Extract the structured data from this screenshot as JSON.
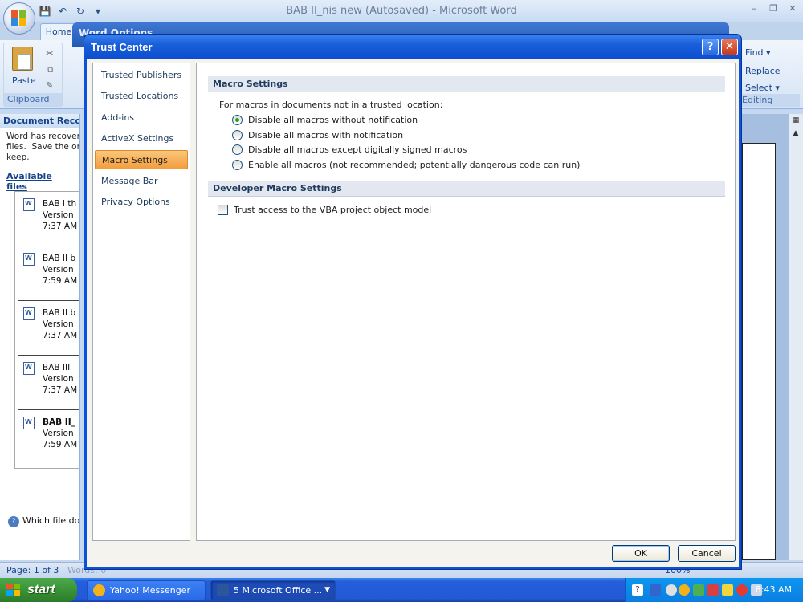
{
  "word": {
    "title": "BAB II_nis new (Autosaved) - Microsoft Word",
    "home_tab": "Home",
    "paste_label": "Paste",
    "clipboard_group": "Clipboard",
    "editing": {
      "find": "Find ▾",
      "replace": "Replace",
      "select": "Select ▾",
      "group": "Editing"
    },
    "status_page": "Page: 1 of 3",
    "status_words": "Words: 0",
    "status_zoom": "100%"
  },
  "recovery": {
    "title": "Document Recovery",
    "message": "Word has recovered\nfiles.  Save the ones\nkeep.",
    "available": "Available files",
    "files": [
      {
        "name": "BAB I th",
        "version": "Version",
        "time": "7:37 AM"
      },
      {
        "name": "BAB II b",
        "version": "Version",
        "time": "7:59 AM"
      },
      {
        "name": "BAB II b",
        "version": "Version",
        "time": "7:37 AM"
      },
      {
        "name": "BAB III",
        "version": "Version",
        "time": "7:37 AM"
      },
      {
        "name": "BAB II_",
        "version": "Version",
        "time": "7:59 AM"
      }
    ],
    "help_link": "Which file do"
  },
  "word_options": {
    "title": "Word Options"
  },
  "trust_center": {
    "title": "Trust Center",
    "nav": [
      "Trusted Publishers",
      "Trusted Locations",
      "Add-ins",
      "ActiveX Settings",
      "Macro Settings",
      "Message Bar",
      "Privacy Options"
    ],
    "active_nav": "Macro Settings",
    "macro_section": "Macro Settings",
    "macro_intro": "For macros in documents not in a trusted location:",
    "options": [
      "Disable all macros without notification",
      "Disable all macros with notification",
      "Disable all macros except digitally signed macros",
      "Enable all macros (not recommended; potentially dangerous code can run)"
    ],
    "selected_option": 0,
    "developer_section": "Developer Macro Settings",
    "trust_vba": "Trust access to the VBA project object model",
    "trust_vba_checked": false,
    "ok": "OK",
    "cancel": "Cancel"
  },
  "taskbar": {
    "start": "start",
    "tasks": [
      "Yahoo! Messenger",
      "5 Microsoft Office ..."
    ],
    "time": "8:43 AM"
  }
}
